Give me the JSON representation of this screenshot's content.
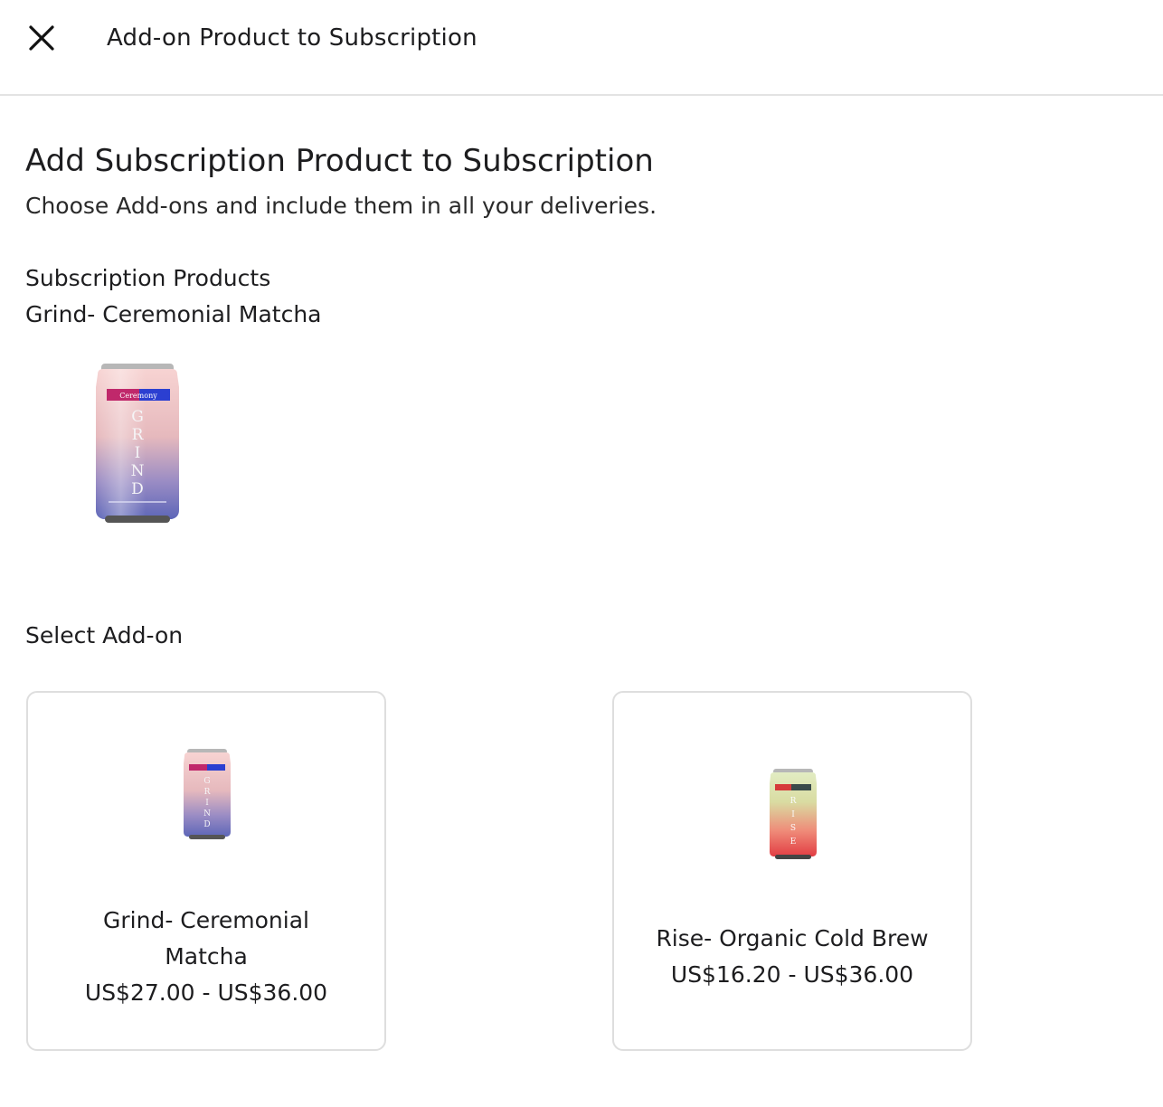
{
  "header": {
    "title": "Add-on Product to Subscription",
    "close_icon": "close-icon"
  },
  "main": {
    "title": "Add Subscription Product to Subscription",
    "subtitle": "Choose Add-ons and include them in all your deliveries.",
    "subscription_section_label": "Subscription Products",
    "current_product": {
      "name": "Grind- Ceremonial Matcha",
      "can_label": "Ceremony",
      "can_word": "GRIND"
    },
    "addon_section_label": "Select Add-on",
    "addons": [
      {
        "name": "Grind- Ceremonial Matcha",
        "price": "US$27.00 - US$36.00",
        "can_word": "GRIND",
        "colors": {
          "top": "#f3c7c9",
          "bottom": "#6f74c4",
          "band": "#c0286b"
        }
      },
      {
        "name": "Rise- Organic Cold Brew",
        "price": "US$16.20 - US$36.00",
        "can_word": "RISE",
        "colors": {
          "top": "#d6e4b4",
          "bottom": "#e5484c",
          "band": "#d63a3a"
        }
      }
    ]
  }
}
